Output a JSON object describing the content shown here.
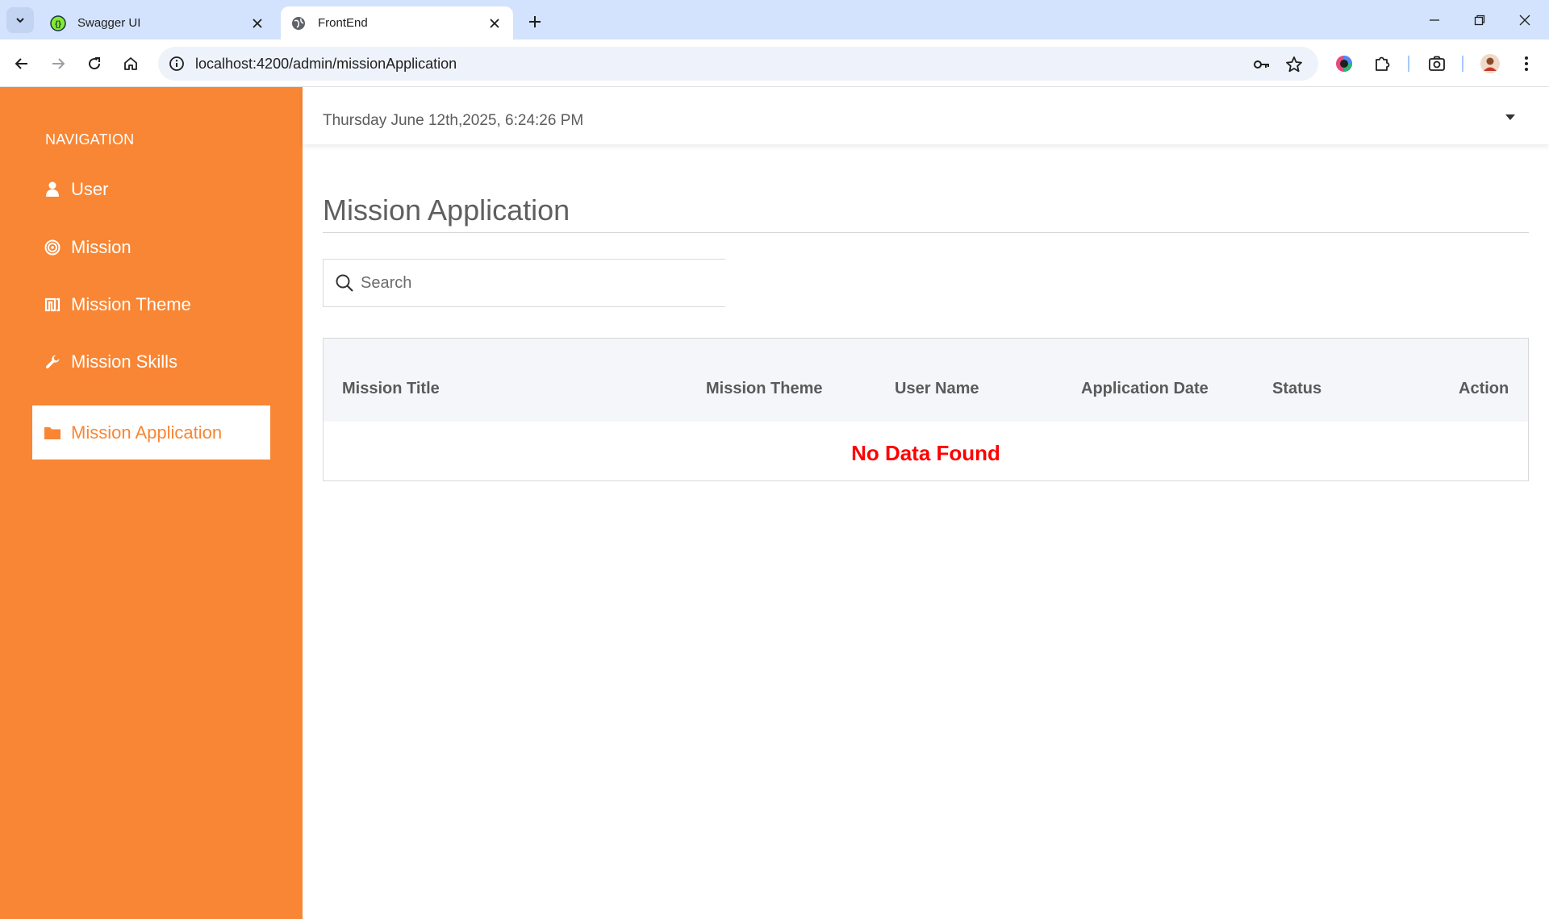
{
  "browser": {
    "tabs": [
      {
        "title": "Swagger UI",
        "icon": "swagger-icon",
        "active": false
      },
      {
        "title": "FrontEnd",
        "icon": "globe-icon",
        "active": true
      }
    ],
    "url": "localhost:4200/admin/missionApplication"
  },
  "sidebar": {
    "heading": "NAVIGATION",
    "items": [
      {
        "label": "User",
        "icon": "user-icon"
      },
      {
        "label": "Mission",
        "icon": "target-icon"
      },
      {
        "label": "Mission Theme",
        "icon": "theme-icon"
      },
      {
        "label": "Mission Skills",
        "icon": "wrench-icon"
      },
      {
        "label": "Mission Application",
        "icon": "folder-icon",
        "active": true
      }
    ]
  },
  "header": {
    "datetime": "Thursday June 12th,2025, 6:24:26 PM"
  },
  "main": {
    "title": "Mission Application",
    "search_placeholder": "Search",
    "table": {
      "columns": [
        "Mission Title",
        "Mission Theme",
        "User Name",
        "Application Date",
        "Status",
        "Action"
      ],
      "empty_message": "No Data Found"
    }
  },
  "colors": {
    "sidebar_bg": "#f88634",
    "empty_message": "#ff0000",
    "tabstrip_bg": "#d3e3fd"
  }
}
